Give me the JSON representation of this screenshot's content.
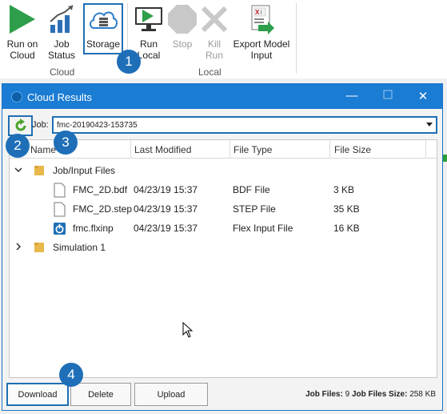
{
  "ribbon": {
    "cloud_group": {
      "label": "Cloud",
      "buttons": [
        {
          "label1": "Run on",
          "label2": "Cloud",
          "icon": "play-green-icon"
        },
        {
          "label1": "Job",
          "label2": "Status",
          "icon": "bar-chart-icon"
        },
        {
          "label1": "Storage",
          "label2": "",
          "icon": "cloud-storage-icon"
        }
      ]
    },
    "local_group": {
      "label": "Local",
      "buttons": [
        {
          "label1": "Run",
          "label2": "Local",
          "icon": "monitor-play-icon"
        },
        {
          "label1": "Stop",
          "label2": "",
          "icon": "stop-octagon-icon"
        },
        {
          "label1": "Kill",
          "label2": "Run",
          "icon": "kill-x-icon"
        },
        {
          "label1": "Export Model",
          "label2": "Input",
          "icon": "export-excel-icon"
        }
      ]
    }
  },
  "dialog": {
    "title": "Cloud Results",
    "job_label": "Job:",
    "job_value": "fmc-20190423-153735",
    "columns": [
      "Name",
      "Last Modified",
      "File Type",
      "File Size"
    ],
    "tree": {
      "folder1": {
        "name": "Job/Input Files"
      },
      "files": [
        {
          "name": "FMC_2D.bdf",
          "modified": "04/23/19 15:37",
          "type": "BDF File",
          "size": "3 KB"
        },
        {
          "name": "FMC_2D.step",
          "modified": "04/23/19 15:37",
          "type": "STEP File",
          "size": "35 KB"
        },
        {
          "name": "fmc.flxinp",
          "modified": "04/23/19 15:37",
          "type": "Flex Input File",
          "size": "16 KB"
        }
      ],
      "folder2": {
        "name": "Simulation 1"
      }
    },
    "buttons": {
      "download": "Download",
      "delete": "Delete",
      "upload": "Upload"
    },
    "stats": {
      "job_files_label": "Job Files:",
      "job_files_value": "9",
      "job_files_size_label": "Job Files Size:",
      "job_files_size_value": "258 KB"
    }
  },
  "badges": [
    "1",
    "2",
    "3",
    "4"
  ],
  "colors": {
    "accent": "#1a7cd3",
    "badge": "#1e6fb8",
    "highlight_border": "#1f6fb4"
  }
}
